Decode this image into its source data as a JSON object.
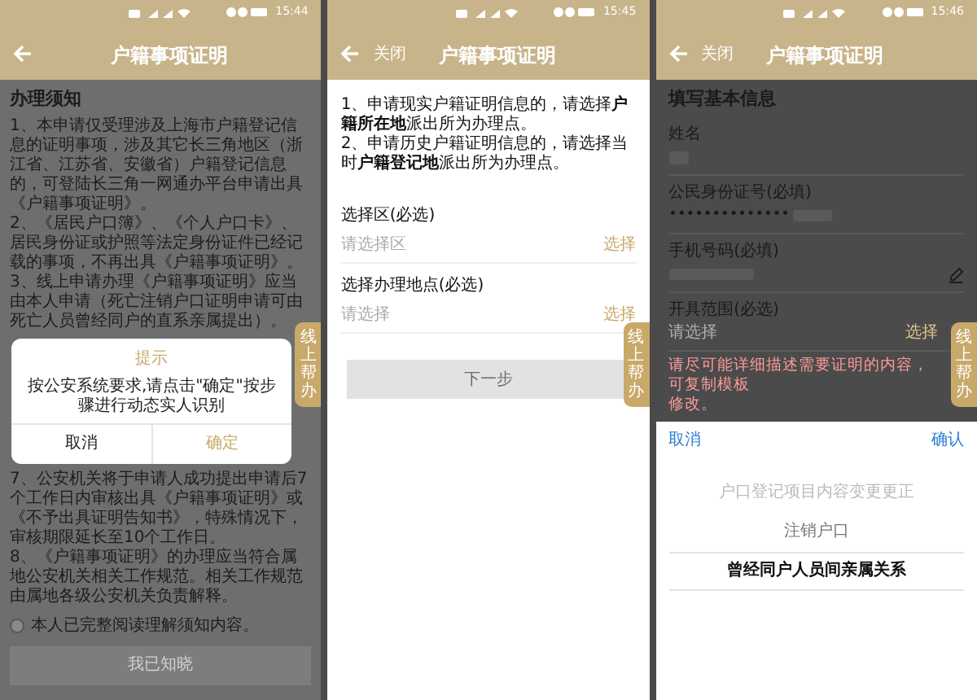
{
  "screens": [
    {
      "kind": "notice",
      "status_bar": {
        "time": "15:44"
      },
      "header": {
        "title": "户籍事项证明"
      },
      "help_tab": {
        "label": "线上帮办"
      },
      "heading": "办理须知",
      "items_before": [
        "1、本申请仅受理涉及上海市户籍登记信息的证明事项，涉及其它长三角地区（浙江省、江苏省、安徽省）户籍登记信息的，可登陆长三角一网通办平台申请出具《户籍事项证明》。",
        "2、《居民户口簿》、《个人户口卡》、居民身份证或护照等法定身份证件已经记载的事项，不再出具《户籍事项证明》。",
        "3、线上申请办理《户籍事项证明》应当由本人申请（死亡注销户口证明申请可由死亡人员曾经同户的直系亲属提出）。"
      ],
      "dialog": {
        "title": "提示",
        "message": "按公安系统要求,请点击\"确定\"按步骤进行动态实人识别",
        "buttons": [
          {
            "label": "取消",
            "kind": "cancel"
          },
          {
            "label": "确定",
            "kind": "confirm"
          }
        ]
      },
      "items_after": [
        "7、公安机关将于申请人成功提出申请后7个工作日内审核出具《户籍事项证明》或《不予出具证明告知书》，特殊情况下，审核期限延长至10个工作日。",
        "8、《户籍事项证明》的办理应当符合属地公安机关相关工作规范。相关工作规范由属地各级公安机关负责解释。"
      ],
      "agreement": {
        "label": "本人已完整阅读理解须知内容。",
        "checked": false
      },
      "button": {
        "label": "我已知晓",
        "disabled": true
      }
    },
    {
      "kind": "location",
      "status_bar": {
        "time": "15:45"
      },
      "header": {
        "close_label": "关闭",
        "title": "户籍事项证明"
      },
      "help_tab": {
        "label": "线上帮办"
      },
      "notes": [
        "1、申请现实户籍证明信息的，请选择**户籍所在地**派出所为办理点。",
        "2、申请历史户籍证明信息的，请选择当时**户籍登记地**派出所为办理点。"
      ],
      "fields": [
        {
          "label": "选择区(必选)",
          "placeholder": "请选择区",
          "action": "选择"
        },
        {
          "label": "选择办理地点(必选)",
          "placeholder": "请选择",
          "action": "选择"
        }
      ],
      "button": {
        "label": "下一步",
        "disabled": true
      }
    },
    {
      "kind": "info",
      "status_bar": {
        "time": "15:46"
      },
      "header": {
        "close_label": "关闭",
        "title": "户籍事项证明"
      },
      "help_tab": {
        "label": "线上帮办"
      },
      "heading": "填写基本信息",
      "fields": [
        {
          "label": "姓名",
          "kind": "blurred"
        },
        {
          "label": "公民身份证号(必填)",
          "kind": "masked",
          "value": "••••••••••••••"
        },
        {
          "label": "手机号码(必填)",
          "kind": "editable"
        },
        {
          "label": "开具范围(必选)",
          "kind": "select",
          "placeholder": "请选择",
          "action": "选择"
        }
      ],
      "note_lines": [
        "请尽可能详细描述需要证明的内容，可复制模板",
        "修改。"
      ],
      "picker": {
        "cancel": "取消",
        "confirm": "确认",
        "options": [
          {
            "label": "户口登记项目内容变更更正",
            "selected": false
          },
          {
            "label": "注销户口",
            "selected": false
          },
          {
            "label": "曾经同户人员间亲属关系",
            "selected": true
          }
        ]
      }
    }
  ]
}
